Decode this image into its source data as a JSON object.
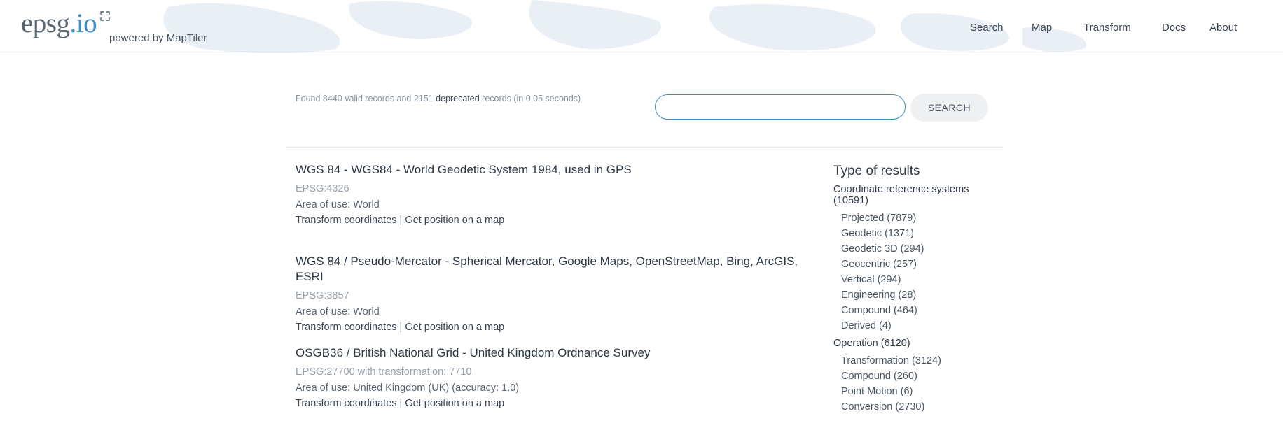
{
  "header": {
    "logo_main": "epsg",
    "logo_io": ".io",
    "powered_by": "powered by MapTiler",
    "nav": {
      "search": "Search",
      "map": "Map",
      "transform": "Transform",
      "docs": "Docs",
      "about": "About"
    }
  },
  "search": {
    "found_prefix": "Found 8440 valid records and 2151 ",
    "found_deprecated": "deprecated",
    "found_suffix": " records (in 0.05 seconds)",
    "input_value": "",
    "button_label": "SEARCH"
  },
  "results": [
    {
      "title": "WGS 84 - WGS84 - World Geodetic System 1984, used in GPS",
      "code": "EPSG:4326",
      "area": "Area of use: World",
      "link_transform": "Transform coordinates",
      "separator": " | ",
      "link_map": "Get position on a map"
    },
    {
      "title": "WGS 84 / Pseudo-Mercator - Spherical Mercator, Google Maps, OpenStreetMap, Bing, ArcGIS, ESRI",
      "code": "EPSG:3857",
      "area": "Area of use: World",
      "link_transform": "Transform coordinates",
      "separator": " | ",
      "link_map": "Get position on a map"
    },
    {
      "title": "OSGB36 / British National Grid - United Kingdom Ordnance Survey",
      "code": "EPSG:27700 with transformation: 7710",
      "area": "Area of use: United Kingdom (UK) (accuracy: 1.0)",
      "link_transform": "Transform coordinates",
      "separator": " | ",
      "link_map": "Get position on a map"
    }
  ],
  "sidebar": {
    "title": "Type of results",
    "crs_group": "Coordinate reference systems (10591)",
    "crs_items": [
      "Projected (7879)",
      "Geodetic (1371)",
      "Geodetic 3D (294)",
      "Geocentric (257)",
      "Vertical (294)",
      "Engineering (28)",
      "Compound (464)",
      "Derived (4)"
    ],
    "op_group": "Operation (6120)",
    "op_items": [
      "Transformation (3124)",
      "Compound (260)",
      "Point Motion (6)",
      "Conversion (2730)"
    ]
  },
  "colors": {
    "accent": "#3d8fc4",
    "text": "#2d3745",
    "muted": "#98a0ab"
  }
}
